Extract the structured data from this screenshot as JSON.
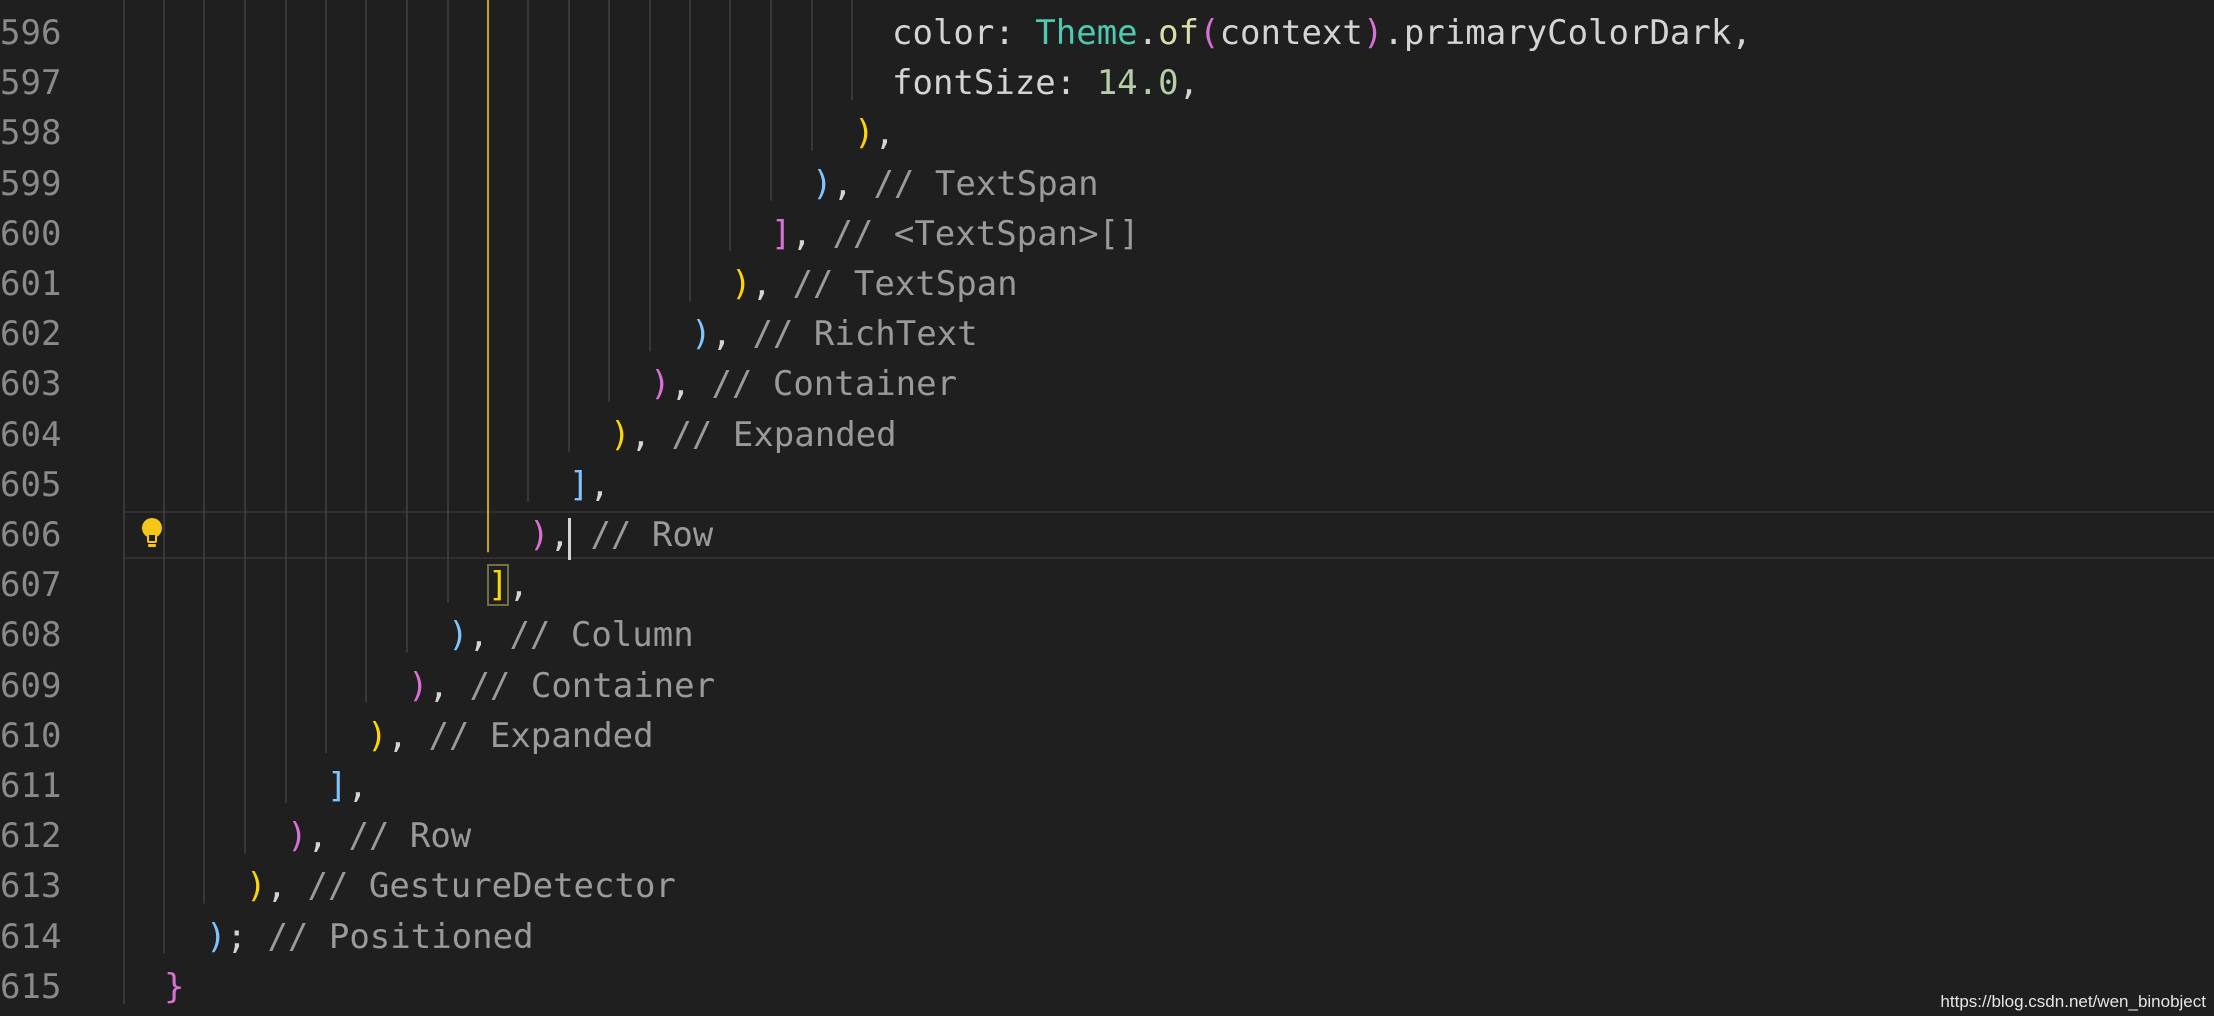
{
  "editor": {
    "lines": [
      {
        "number": "596",
        "tokens": [
          {
            "text": "color: ",
            "style": "plain"
          },
          {
            "text": "Theme",
            "style": "type"
          },
          {
            "text": ".",
            "style": "plain"
          },
          {
            "text": "of",
            "style": "func"
          },
          {
            "text": "(",
            "style": "pink"
          },
          {
            "text": "context",
            "style": "plain"
          },
          {
            "text": ")",
            "style": "pink"
          },
          {
            "text": ".primaryColorDark,",
            "style": "plain"
          }
        ]
      },
      {
        "number": "597",
        "tokens": [
          {
            "text": "fontSize: ",
            "style": "plain"
          },
          {
            "text": "14.0",
            "style": "number"
          },
          {
            "text": ",",
            "style": "plain"
          }
        ]
      },
      {
        "number": "598",
        "tokens": [
          {
            "text": ")",
            "style": "yellow"
          },
          {
            "text": ",",
            "style": "plain"
          }
        ]
      },
      {
        "number": "599",
        "tokens": [
          {
            "text": ")",
            "style": "blue"
          },
          {
            "text": ", ",
            "style": "plain"
          },
          {
            "text": "// TextSpan",
            "style": "comment"
          }
        ]
      },
      {
        "number": "600",
        "tokens": [
          {
            "text": "]",
            "style": "pink"
          },
          {
            "text": ", ",
            "style": "plain"
          },
          {
            "text": "// <TextSpan>[]",
            "style": "comment"
          }
        ]
      },
      {
        "number": "601",
        "tokens": [
          {
            "text": ")",
            "style": "yellow"
          },
          {
            "text": ", ",
            "style": "plain"
          },
          {
            "text": "// TextSpan",
            "style": "comment"
          }
        ]
      },
      {
        "number": "602",
        "tokens": [
          {
            "text": ")",
            "style": "blue"
          },
          {
            "text": ", ",
            "style": "plain"
          },
          {
            "text": "// RichText",
            "style": "comment"
          }
        ]
      },
      {
        "number": "603",
        "tokens": [
          {
            "text": ")",
            "style": "pink"
          },
          {
            "text": ", ",
            "style": "plain"
          },
          {
            "text": "// Container",
            "style": "comment"
          }
        ]
      },
      {
        "number": "604",
        "tokens": [
          {
            "text": ")",
            "style": "yellow"
          },
          {
            "text": ", ",
            "style": "plain"
          },
          {
            "text": "// Expanded",
            "style": "comment"
          }
        ]
      },
      {
        "number": "605",
        "tokens": [
          {
            "text": "]",
            "style": "blue"
          },
          {
            "text": ",",
            "style": "plain"
          }
        ]
      },
      {
        "number": "606",
        "tokens": [
          {
            "text": ")",
            "style": "pink"
          },
          {
            "text": ", ",
            "style": "plain"
          },
          {
            "text": "// Row",
            "style": "comment"
          }
        ]
      },
      {
        "number": "607",
        "tokens": [
          {
            "text": "]",
            "style": "yellow",
            "match": true
          },
          {
            "text": ",",
            "style": "plain"
          }
        ]
      },
      {
        "number": "608",
        "tokens": [
          {
            "text": ")",
            "style": "blue"
          },
          {
            "text": ", ",
            "style": "plain"
          },
          {
            "text": "// Column",
            "style": "comment"
          }
        ]
      },
      {
        "number": "609",
        "tokens": [
          {
            "text": ")",
            "style": "pink"
          },
          {
            "text": ", ",
            "style": "plain"
          },
          {
            "text": "// Container",
            "style": "comment"
          }
        ]
      },
      {
        "number": "610",
        "tokens": [
          {
            "text": ")",
            "style": "yellow"
          },
          {
            "text": ", ",
            "style": "plain"
          },
          {
            "text": "// Expanded",
            "style": "comment"
          }
        ]
      },
      {
        "number": "611",
        "tokens": [
          {
            "text": "]",
            "style": "blue"
          },
          {
            "text": ",",
            "style": "plain"
          }
        ]
      },
      {
        "number": "612",
        "tokens": [
          {
            "text": ")",
            "style": "pink"
          },
          {
            "text": ", ",
            "style": "plain"
          },
          {
            "text": "// Row",
            "style": "comment"
          }
        ]
      },
      {
        "number": "613",
        "tokens": [
          {
            "text": ")",
            "style": "yellow"
          },
          {
            "text": ", ",
            "style": "plain"
          },
          {
            "text": "// GestureDetector",
            "style": "comment"
          }
        ]
      },
      {
        "number": "614",
        "tokens": [
          {
            "text": ")",
            "style": "blue"
          },
          {
            "text": "; ",
            "style": "plain"
          },
          {
            "text": "// Positioned",
            "style": "comment"
          }
        ]
      },
      {
        "number": "615",
        "tokens": [
          {
            "text": "}",
            "style": "pink"
          }
        ]
      }
    ],
    "current_line": "606"
  },
  "icons": {
    "lightbulb": "lightbulb-icon"
  },
  "colors": {
    "background": "#1f1f1f",
    "bracket_yellow": "#ffd700",
    "bracket_blue": "#7fc4ff",
    "bracket_pink": "#da70d6",
    "comment": "#9a9a9a",
    "type": "#4ec9b0",
    "function": "#dcdcaa",
    "number": "#b5cea8",
    "active_guide": "#c9a227"
  },
  "watermark": {
    "text": "https://blog.csdn.net/wen_binobject"
  }
}
